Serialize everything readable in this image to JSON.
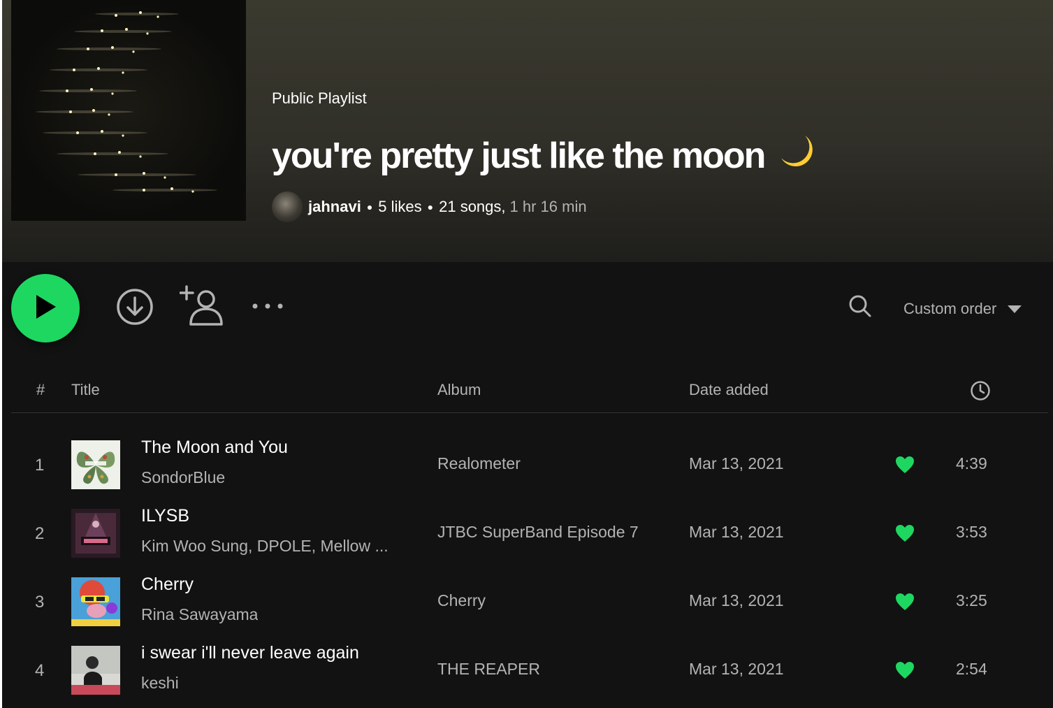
{
  "playlist": {
    "type_label": "Public Playlist",
    "title": "you're pretty just like the moon",
    "title_emoji_icon": "crescent-moon-icon",
    "owner": "jahnavi",
    "likes": "5 likes",
    "song_count": "21 songs,",
    "duration": "1 hr 16 min"
  },
  "actions": {
    "play_icon": "play-icon",
    "download_icon": "download-icon",
    "follow_icon": "add-user-icon",
    "more_icon": "more-options-icon",
    "search_icon": "search-icon",
    "sort_label": "Custom order"
  },
  "table": {
    "headers": {
      "num": "#",
      "title": "Title",
      "album": "Album",
      "date_added": "Date added",
      "duration_icon": "clock-icon"
    },
    "rows": [
      {
        "num": "1",
        "title": "The Moon and You",
        "artist": "SondorBlue",
        "album": "Realometer",
        "date": "Mar 13, 2021",
        "duration": "4:39",
        "liked": true
      },
      {
        "num": "2",
        "title": "ILYSB",
        "artist": "Kim Woo Sung, DPOLE, Mellow ...",
        "album": "JTBC SuperBand Episode 7",
        "date": "Mar 13, 2021",
        "duration": "3:53",
        "liked": true
      },
      {
        "num": "3",
        "title": "Cherry",
        "artist": "Rina Sawayama",
        "album": "Cherry",
        "date": "Mar 13, 2021",
        "duration": "3:25",
        "liked": true
      },
      {
        "num": "4",
        "title": "i swear i'll never leave again",
        "artist": "keshi",
        "album": "THE REAPER",
        "date": "Mar 13, 2021",
        "duration": "2:54",
        "liked": true
      }
    ]
  },
  "colors": {
    "accent": "#1ed760",
    "background": "#121212",
    "header_tint": "#3b3a2f",
    "text_secondary": "#b3b3b3"
  }
}
